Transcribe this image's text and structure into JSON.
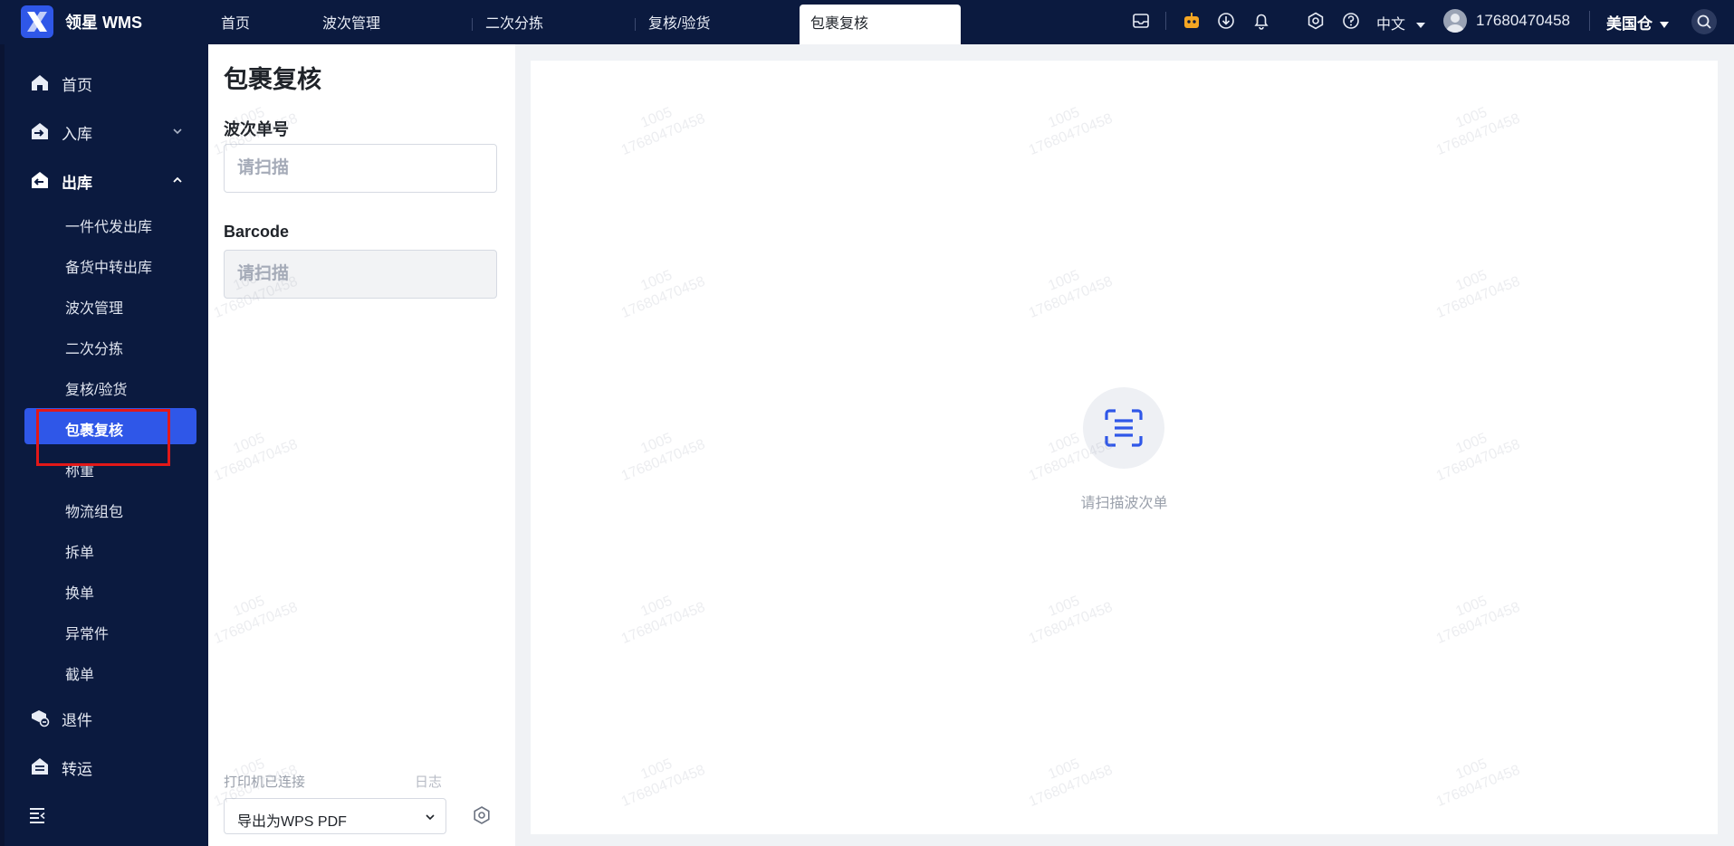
{
  "app": {
    "name": "领星 WMS"
  },
  "tabs": [
    "首页",
    "波次管理",
    "二次分拣",
    "复核/验货",
    "包裹复核"
  ],
  "header": {
    "language": "中文",
    "user": "17680470458",
    "warehouse": "美国仓"
  },
  "sidebar": {
    "home": "首页",
    "inbound": "入库",
    "outbound": "出库",
    "outbound_items": [
      "一件代发出库",
      "备货中转出库",
      "波次管理",
      "二次分拣",
      "复核/验货",
      "包裹复核",
      "称重",
      "物流组包",
      "拆单",
      "换单",
      "异常件",
      "截单"
    ],
    "returns": "退件",
    "transfer": "转运"
  },
  "panel": {
    "title": "包裹复核",
    "wave_label": "波次单号",
    "wave_placeholder": "请扫描",
    "barcode_label": "Barcode",
    "barcode_placeholder": "请扫描",
    "printer_status": "打印机已连接",
    "log": "日志",
    "printer": "导出为WPS PDF"
  },
  "main": {
    "empty_text": "请扫描波次单"
  },
  "watermark": {
    "line1": "1005",
    "line2": "17680470458"
  },
  "colors": {
    "nav_bg": "#0b1a3f",
    "accent": "#2f57e8",
    "highlight_border": "#e21818",
    "robot_icon": "#f5a623"
  }
}
